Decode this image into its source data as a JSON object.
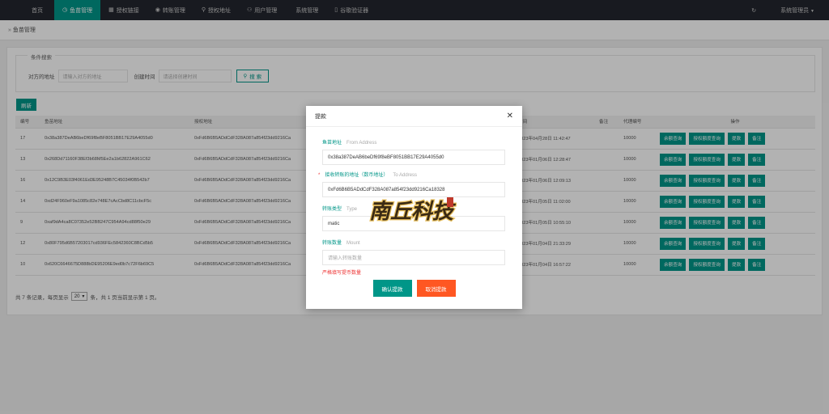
{
  "topnav": {
    "items": [
      {
        "icon": "home-icon",
        "glyph": "",
        "label": "首页"
      },
      {
        "icon": "clock-icon",
        "glyph": "◷",
        "label": "鱼苗管理"
      },
      {
        "icon": "grid-icon",
        "glyph": "▦",
        "label": "授权链接"
      },
      {
        "icon": "transfer-icon",
        "glyph": "◉",
        "label": "转账管理"
      },
      {
        "icon": "location-icon",
        "glyph": "⚲",
        "label": "授权地址"
      },
      {
        "icon": "user-icon",
        "glyph": "⚇",
        "label": "用户管理"
      },
      {
        "icon": "settings-icon",
        "glyph": "",
        "label": "系统管理"
      },
      {
        "icon": "phone-icon",
        "glyph": "▯",
        "label": "谷歌验证器"
      }
    ],
    "refresh_glyph": "↻",
    "admin_label": "系统管理员",
    "active_color": "#009688"
  },
  "breadcrumb": {
    "label": "鱼苗管理"
  },
  "search": {
    "legend": "条件搜索",
    "address_label": "对方的地址",
    "address_placeholder": "请输入对方的地址",
    "time_label": "创建时间",
    "time_placeholder": "请选择创建时间",
    "search_button": "搜 索"
  },
  "refresh_button": "刷新",
  "table": {
    "headers": [
      "编号",
      "鱼苗地址",
      "授权地址",
      "时间",
      "备注",
      "代理编号",
      "操作"
    ],
    "ops": [
      "余额查询",
      "授权额度查询",
      "提款",
      "备注"
    ],
    "rows": [
      {
        "id": "17",
        "from": "0x38a387DeAB6beDf69f8eBF8051BB17E29A4055d0",
        "to": "0xFd6B6B5ADdCdF328A087a854f23dd9216Ca",
        "time": "2023年04月28日 11:42:47",
        "remark": "",
        "agent": "10000"
      },
      {
        "id": "13",
        "from": "0x268Dd71160F38Ef3b68M5Ee2a1b62822A961C62",
        "to": "0xFd6B6B5ADdCdF328A087a854f23dd9216Ca",
        "time": "2023年01月06日 12:28:47",
        "remark": "",
        "agent": "10000"
      },
      {
        "id": "16",
        "from": "0x12C9B3E03f4061Ed3E95248B7C45034f0B542b7",
        "to": "0xFd6B6B5ADdCdF328A087a854f23dd9216Ca",
        "time": "2023年01月06日 12:09:13",
        "remark": "",
        "agent": "10000"
      },
      {
        "id": "14",
        "from": "0xd24F960eF9a1085c82e748E7cAcCbd8C11cbcF5c",
        "to": "0xFd6B6B5ADdCdF328A087a854f23dd9216Ca",
        "time": "2023年01月05日 11:02:00",
        "remark": "",
        "agent": "10000"
      },
      {
        "id": "9",
        "from": "0xaf9dA4ca8C07352e52BB247C954A94cd88f50e29",
        "to": "0xFd6B6B5ADdCdF328A087a854f23dd9216Ca",
        "time": "2023年01月05日 10:55:10",
        "remark": "",
        "agent": "10000"
      },
      {
        "id": "12",
        "from": "0x80F795d6B57203017cd936FEc5842360C8BCd5b5",
        "to": "0xFd6B6B5ADdCdF328A087a854f23dd9216Ca",
        "time": "2023年01月04日 21:33:29",
        "remark": "",
        "agent": "10000"
      },
      {
        "id": "10",
        "from": "0x620C6646675D888bDE95206E9ed0b7c72F6b69C5",
        "to": "0xFd6B6B5ADdCdF328A087a854f23dd9216Ca",
        "time": "2023年01月04日 16:57:22",
        "remark": "",
        "agent": "10000"
      }
    ]
  },
  "pager": {
    "prefix": "共 7 条记录，每页显示",
    "page_size": "20",
    "suffix": "条，共 1 页当前显示第 1 页。"
  },
  "modal": {
    "title": "提款",
    "from_label": "鱼苗地址",
    "from_label_en": "From Address",
    "from_value": "0x38a387DeAB6beDf69f8eBF8051BB17E29A4055d0",
    "to_star": "*",
    "to_label": "接收转账的地址（数币地址）",
    "to_label_en": "To Address",
    "to_value": "0xFd6B6B5ADdCdF328A087a854f23dd9216Ca18328",
    "type_label": "转账类型",
    "type_label_en": "Type",
    "type_value": "matic",
    "amount_label": "转账数量",
    "amount_label_en": "Mount",
    "amount_placeholder": "请输入转账数量",
    "warning": "严格填写提币数量",
    "confirm_button": "确认提款",
    "cancel_button": "取消提款",
    "confirm_color": "#009688",
    "cancel_color": "#ff5722"
  },
  "watermark": {
    "text": "南丘科技"
  }
}
